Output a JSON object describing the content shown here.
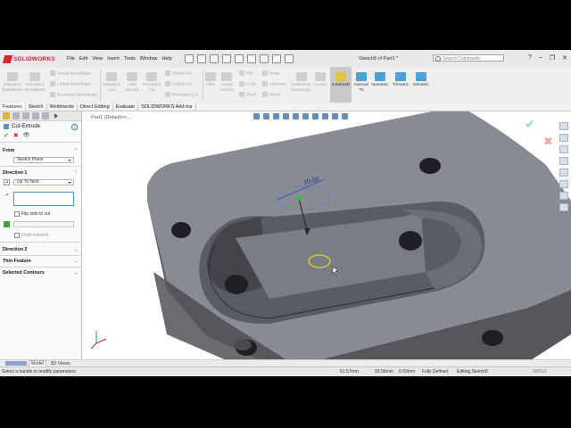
{
  "app": {
    "brand": "SOLIDWORKS",
    "doc_title": "Sketch8 of Part1 *"
  },
  "menu": [
    "File",
    "Edit",
    "View",
    "Insert",
    "Tools",
    "Window",
    "Help"
  ],
  "search": {
    "placeholder": "Search Commands"
  },
  "commands": {
    "extruded_boss": "Extruded Boss/Base",
    "revolved_boss": "Revolved Boss/Base",
    "swept_boss": "Swept Boss/Base",
    "lofted_boss": "Lofted Boss/Base",
    "boundary_boss": "Boundary Boss/Base",
    "extruded_cut": "Extruded Cut",
    "hole_wizard": "Hole Wizard",
    "revolved_cut": "Revolved Cut",
    "swept_cut": "Swept Cut",
    "lofted_cut": "Lofted Cut",
    "boundary_cut": "Boundary Cut",
    "fillet": "Fillet",
    "linear_pattern": "Linear Pattern",
    "rib": "Rib",
    "draft": "Draft",
    "shell": "Shell",
    "wrap": "Wrap",
    "intersect": "Intersect",
    "mirror": "Mirror",
    "reference_geometry": "Reference Geometry",
    "curves": "Curves",
    "instant3d": "Instant3D",
    "normal_to": "Normal To",
    "isometric": "Isometric",
    "trimetric": "Trimetric",
    "dimetric": "Dimetric"
  },
  "tabs": [
    "Features",
    "Sketch",
    "Weldments",
    "Direct Editing",
    "Evaluate",
    "SOLIDWORKS Add-Ins"
  ],
  "feature": {
    "title": "Cut-Extrude",
    "ok": "✔",
    "cancel": "✖",
    "preview": "👁",
    "from_label": "From",
    "from_value": "Sketch Plane",
    "direction1_label": "Direction 1",
    "end_condition": "Up To Next",
    "flip_side": "Flip side to cut",
    "draft_outward": "Draft outward",
    "direction2_label": "Direction 2",
    "thin_feature_label": "Thin Feature",
    "selected_contours_label": "Selected Contours"
  },
  "viewport": {
    "part_label": "Part1  (Default<<...",
    "dimension": "10.00",
    "confirm_ok": "✔",
    "confirm_cancel": "✖"
  },
  "bottom_tabs": {
    "model": "Model",
    "views3d": "3D Views"
  },
  "status": {
    "message": "Select a handle to modify parameters",
    "x": "61.57mm",
    "y": "93.56mm",
    "z": "0.00mm",
    "state": "Fully Defined",
    "editing": "Editing Sketch8",
    "units": "MMGS"
  }
}
